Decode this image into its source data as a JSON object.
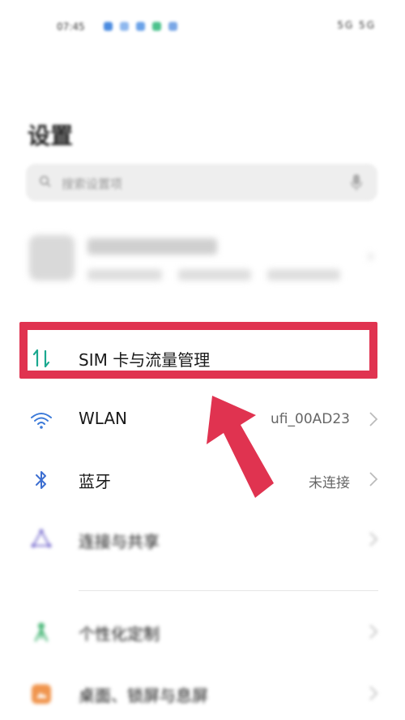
{
  "status_bar": {
    "time": "07:45",
    "indicators": "5G 5G"
  },
  "title": "设置",
  "search": {
    "placeholder": "搜索设置项"
  },
  "settings": [
    {
      "id": "sim",
      "label": "SIM 卡与流量管理",
      "value": "",
      "icon": "sim-data-icon"
    },
    {
      "id": "wlan",
      "label": "WLAN",
      "value": "ufi_00AD23",
      "icon": "wifi-icon"
    },
    {
      "id": "bluetooth",
      "label": "蓝牙",
      "value": "未连接",
      "icon": "bluetooth-icon"
    },
    {
      "id": "share",
      "label": "连接与共享",
      "value": "",
      "icon": "connection-share-icon"
    },
    {
      "id": "personalize",
      "label": "个性化定制",
      "value": "",
      "icon": "personalize-icon"
    },
    {
      "id": "desktop",
      "label": "桌面、锁屏与息屏",
      "value": "",
      "icon": "desktop-icon"
    }
  ],
  "colors": {
    "highlight": "#e03350",
    "sim_icon": "#1aa88f",
    "wifi_icon": "#3d7bd9",
    "bluetooth_icon": "#3d6fd1"
  }
}
